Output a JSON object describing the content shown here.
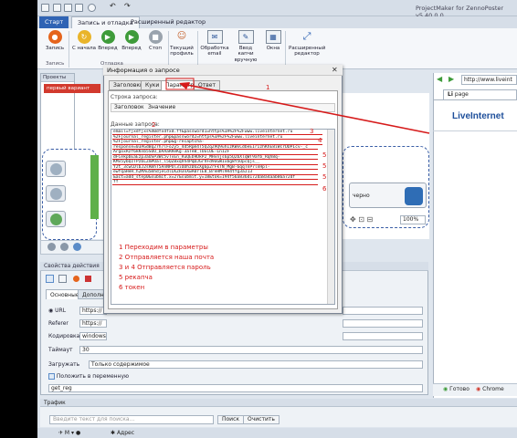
{
  "app": {
    "title": "ProjectMaker for ZennoPoster v5.40.0.0"
  },
  "menu_tabs": [
    "Старт",
    "Запись и отладка",
    "Расширенный редактор"
  ],
  "ribbon": {
    "buttons": [
      "Запись",
      "С начала",
      "Вперед",
      "Вперед",
      "Стоп",
      "Текущий профиль",
      "Обработка email",
      "Ввод капчи вручную",
      "Окна",
      "Расширенный редактор"
    ],
    "groups": [
      "Запись",
      "Отладка"
    ]
  },
  "projects_panel": {
    "title": "Проекты",
    "tab": "первый вариант"
  },
  "dialog": {
    "title": "Информация о запросе",
    "tabs": [
      "Заголовки",
      "Куки",
      "Параметры",
      "Ответ"
    ],
    "query_string_label": "Строка запроса:",
    "col_header": "Заголовок",
    "col_value": "Значение",
    "data_label": "Данные запроса:",
    "request_lines": [
      "email=fjxdfjxs%40dfxdfxd.ff&password1=https%3A%2F%2Fwww.liveinternet.ru",
      "%2Fjournal_register.php&password2=https%3A%2F%2Fwww.liveinternet.ru",
      "%2Fjournal_register.php&g-recaptcha-",
      "response=03AGdBq27h7lFo2y5_4d5Rpm4T5Q2qZ9Q9uhIzKWxCdbeEIrIzhKhE8iWcrDDPIcv-_c",
      "ArgoxRzf6kKnb5SUO_DAAaRReKg-3aTeB_lOECUE-Ln1ZF",
      "dFCekpbEaEzp3aUSP3Wc5vTvEn_RuQEb9DkP2_MHvnjs6p5Q2bXlqWT9aYb_Rqh8q-",
      "KMv5ybQzTPzbLZmPUaT_l5QZ8xqVh4PqDJGrVFd9oGW1xbg8Y5UpcQjs__",
      "Y2t_3cwCDlbJ2sRmhT5AnNPOl3iODhzDUZXg6p2rFkTN_MgB-6qqTnP7lnHpl-",
      "ewfqaHeH_h2MAu5mhdjeCdlLKZH3nXwA0rlE8_BreHMl9R4tfg3aJ13",
      "&act=add_step0&submit.x=27&submit.y=18&tok=194f56a836d172da8a4aab86a72df",
      "ff"
    ]
  },
  "annotations": [
    "1 Переходим в параметры",
    "2 Отправляется наша почта",
    "3 и 4 Отправляется пароль",
    "5 рекапча",
    "6 токен"
  ],
  "properties": {
    "title": "Свойства действия",
    "tabs": [
      "Основные",
      "Дополнительно"
    ],
    "url_label": "URL",
    "url_value": "https://",
    "referer_label": "Referer",
    "referer_value": "https://",
    "encoding_label": "Кодировка",
    "encoding_value": "windows",
    "timeout_label": "Таймаут",
    "timeout_value": "30",
    "load_label": "Загружать",
    "load_value": "Только содержимое",
    "put_var_label": "Положить в переменную",
    "var_value": "get_reg"
  },
  "traffic": {
    "title": "Трафик",
    "search_placeholder": "Введите текст для поиска...",
    "search_button": "Поиск",
    "clear_button": "Очистить"
  },
  "browser": {
    "address": "http://www.liveint",
    "tab_label": "page",
    "logo": "LiveInternet",
    "zoom": "100%",
    "ready": "Готово",
    "engine": "Chrome"
  },
  "canvas_btn": "черно",
  "statusbar": {
    "address_label": "Адрес"
  }
}
